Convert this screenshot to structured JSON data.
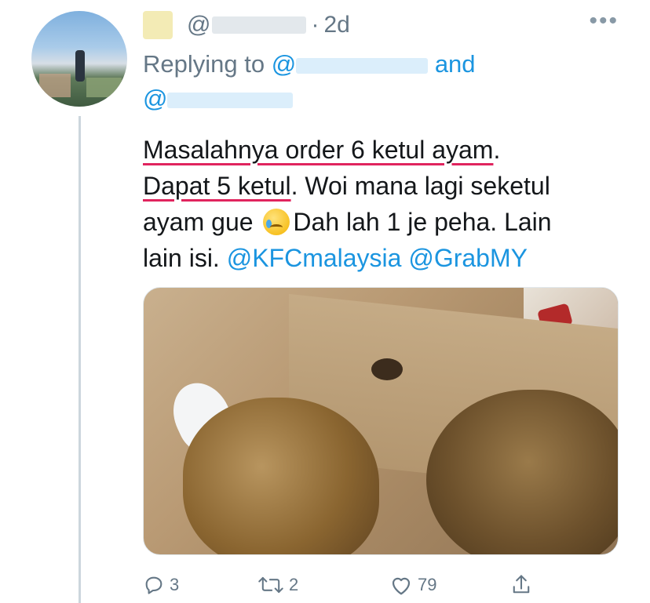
{
  "tweet": {
    "handle_prefix": "@",
    "separator": "·",
    "time": "2d",
    "more_glyph": "•••",
    "replying_to_prefix": "Replying to ",
    "replying_and": " and",
    "reply_at": "@",
    "text": {
      "line1_underlined": "Masalahnya order 6 ketul ayam",
      "line1_end": ".",
      "line2_underlined": "Dapat 5 ketul",
      "line2_rest": ". Woi mana lagi seketul",
      "line3_start": "ayam gue ",
      "line3_rest": "Dah lah 1 je peha. Lain",
      "line4_start": "lain isi. ",
      "mention1": "@KFCmalaysia",
      "mention2": "@GrabMY"
    },
    "actions": {
      "replies": "3",
      "retweets": "2",
      "likes": "79"
    }
  },
  "colors": {
    "link": "#1b95e0",
    "muted": "#657786",
    "underline": "#e0245e"
  },
  "icons": [
    "reply-icon",
    "retweet-icon",
    "like-icon",
    "share-icon",
    "more-icon",
    "crying-emoji-icon"
  ]
}
